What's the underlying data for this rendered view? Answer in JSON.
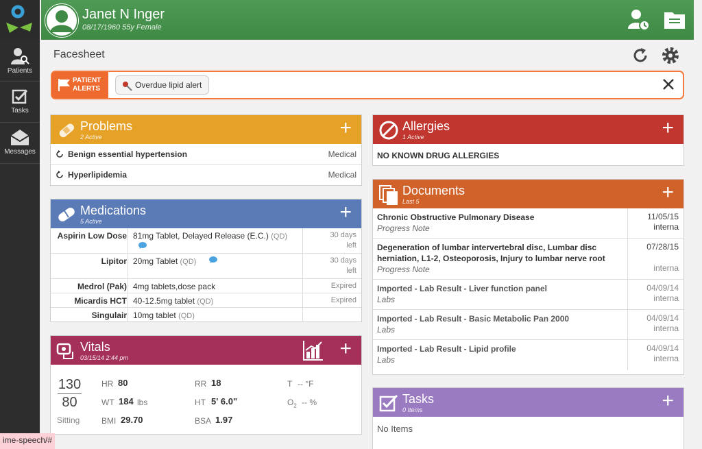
{
  "nav": {
    "items": [
      {
        "label": "Patients"
      },
      {
        "label": "Tasks"
      },
      {
        "label": "Messages"
      }
    ]
  },
  "patient": {
    "name": "Janet N Inger",
    "dob_line": "08/17/1960 55y Female"
  },
  "page": {
    "title": "Facesheet"
  },
  "alerts": {
    "badge_line1": "PATIENT",
    "badge_line2": "ALERTS",
    "chips": [
      {
        "label": "Overdue lipid alert"
      }
    ]
  },
  "problems": {
    "title": "Problems",
    "subtitle": "2 Active",
    "items": [
      {
        "name": "Benign essential hypertension",
        "category": "Medical"
      },
      {
        "name": "Hyperlipidemia",
        "category": "Medical"
      }
    ]
  },
  "medications": {
    "title": "Medications",
    "subtitle": "5 Active",
    "items": [
      {
        "name": "Aspirin Low Dose",
        "dose": "81mg Tablet, Delayed Release (E.C.)",
        "freq": "(QD)",
        "status": "30 days",
        "status2": "left",
        "comment": true
      },
      {
        "name": "Lipitor",
        "dose": "20mg Tablet",
        "freq": "(QD)",
        "status": "30 days",
        "status2": "left",
        "comment": true
      },
      {
        "name": "Medrol (Pak)",
        "dose": "4mg tablets,dose pack",
        "freq": "",
        "status": "Expired",
        "status2": "",
        "comment": false
      },
      {
        "name": "Micardis HCT",
        "dose": "40-12.5mg tablet",
        "freq": "(QD)",
        "status": "Expired",
        "status2": "",
        "comment": false
      },
      {
        "name": "Singulair",
        "dose": "10mg tablet",
        "freq": "(QD)",
        "status": "",
        "status2": "",
        "comment": false
      }
    ]
  },
  "vitals": {
    "title": "Vitals",
    "subtitle": "03/15/14 2:44 pm",
    "bp_sys": "130",
    "bp_dia": "80",
    "bp_pos": "Sitting",
    "hr_label": "HR",
    "hr": "80",
    "wt_label": "WT",
    "wt": "184",
    "wt_unit": "lbs",
    "bmi_label": "BMI",
    "bmi": "29.70",
    "rr_label": "RR",
    "rr": "18",
    "ht_label": "HT",
    "ht": "5' 6.0\"",
    "bsa_label": "BSA",
    "bsa": "1.97",
    "t_label": "T",
    "t_val": "-- °F",
    "o2_label": "O",
    "o2_sub": "2",
    "o2_val": "-- %"
  },
  "allergies": {
    "title": "Allergies",
    "subtitle": "1 Active",
    "items": [
      {
        "name": "NO KNOWN DRUG ALLERGIES"
      }
    ]
  },
  "documents": {
    "title": "Documents",
    "subtitle": "Last 5",
    "items": [
      {
        "title": "Chronic Obstructive Pulmonary Disease",
        "type": "Progress Note",
        "date": "11/05/15",
        "src": "interna"
      },
      {
        "title": "Degeneration of lumbar intervertebral disc, Lumbar disc herniation, L1-2, Osteoporosis, Injury to lumbar nerve root",
        "type": "Progress Note",
        "date": "07/28/15",
        "src": "interna"
      },
      {
        "title": "Imported - Lab Result - Liver function panel",
        "type": "Labs",
        "date": "04/09/14",
        "src": "interna"
      },
      {
        "title": "Imported - Lab Result - Basic Metabolic Pan 2000",
        "type": "Labs",
        "date": "04/09/14",
        "src": "interna"
      },
      {
        "title": "Imported - Lab Result - Lipid profile",
        "type": "Labs",
        "date": "04/09/14",
        "src": "interna"
      }
    ]
  },
  "tasks": {
    "title": "Tasks",
    "subtitle": "0 Items",
    "empty": "No Items"
  },
  "statusbar": {
    "url": "ime-speech/#"
  },
  "colors": {
    "problems": "#e6a127",
    "medications": "#5b7bb7",
    "vitals": "#a4305a",
    "allergies": "#c1362e",
    "documents": "#d0622a",
    "tasks": "#9a7ac0",
    "alert": "#ef6a2e",
    "header": "#45904a"
  }
}
